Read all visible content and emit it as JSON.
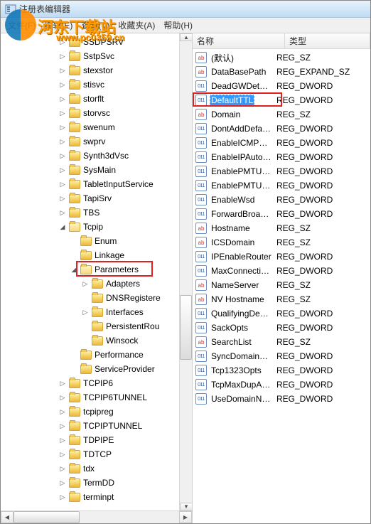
{
  "window": {
    "title": "注册表编辑器"
  },
  "menu": {
    "file": "文件(F)",
    "edit": "编辑(E)",
    "view": "查看(V)",
    "favorites": "收藏夹(A)",
    "help": "帮助(H)"
  },
  "watermark": {
    "main": "河东下载站",
    "sub": "www.pc0359.cn"
  },
  "tree": {
    "nodes": [
      {
        "level": 5,
        "tog": "▷",
        "label": "SSDPSRV"
      },
      {
        "level": 5,
        "tog": "▷",
        "label": "SstpSvc"
      },
      {
        "level": 5,
        "tog": "▷",
        "label": "stexstor"
      },
      {
        "level": 5,
        "tog": "▷",
        "label": "stisvc"
      },
      {
        "level": 5,
        "tog": "▷",
        "label": "storflt"
      },
      {
        "level": 5,
        "tog": "▷",
        "label": "storvsc"
      },
      {
        "level": 5,
        "tog": "▷",
        "label": "swenum"
      },
      {
        "level": 5,
        "tog": "▷",
        "label": "swprv"
      },
      {
        "level": 5,
        "tog": "▷",
        "label": "Synth3dVsc"
      },
      {
        "level": 5,
        "tog": "▷",
        "label": "SysMain"
      },
      {
        "level": 5,
        "tog": "▷",
        "label": "TabletInputService"
      },
      {
        "level": 5,
        "tog": "▷",
        "label": "TapiSrv"
      },
      {
        "level": 5,
        "tog": "▷",
        "label": "TBS"
      },
      {
        "level": 5,
        "tog": "◢",
        "label": "Tcpip",
        "open": true
      },
      {
        "level": 6,
        "tog": " ",
        "label": "Enum"
      },
      {
        "level": 6,
        "tog": " ",
        "label": "Linkage"
      },
      {
        "level": 6,
        "tog": "◢",
        "label": "Parameters",
        "open": true,
        "highlight": true
      },
      {
        "level": 7,
        "tog": "▷",
        "label": "Adapters"
      },
      {
        "level": 7,
        "tog": " ",
        "label": "DNSRegistere"
      },
      {
        "level": 7,
        "tog": "▷",
        "label": "Interfaces"
      },
      {
        "level": 7,
        "tog": " ",
        "label": "PersistentRou"
      },
      {
        "level": 7,
        "tog": " ",
        "label": "Winsock"
      },
      {
        "level": 6,
        "tog": " ",
        "label": "Performance"
      },
      {
        "level": 6,
        "tog": " ",
        "label": "ServiceProvider"
      },
      {
        "level": 5,
        "tog": "▷",
        "label": "TCPIP6"
      },
      {
        "level": 5,
        "tog": "▷",
        "label": "TCPIP6TUNNEL"
      },
      {
        "level": 5,
        "tog": "▷",
        "label": "tcpipreg"
      },
      {
        "level": 5,
        "tog": "▷",
        "label": "TCPIPTUNNEL"
      },
      {
        "level": 5,
        "tog": "▷",
        "label": "TDPIPE"
      },
      {
        "level": 5,
        "tog": "▷",
        "label": "TDTCP"
      },
      {
        "level": 5,
        "tog": "▷",
        "label": "tdx"
      },
      {
        "level": 5,
        "tog": "▷",
        "label": "TermDD"
      },
      {
        "level": 5,
        "tog": "▷",
        "label": "terminpt"
      }
    ]
  },
  "list": {
    "header": {
      "name": "名称",
      "type": "类型"
    },
    "rows": [
      {
        "icon": "sz",
        "name": "(默认)",
        "type": "REG_SZ"
      },
      {
        "icon": "sz",
        "name": "DataBasePath",
        "type": "REG_EXPAND_SZ"
      },
      {
        "icon": "dw",
        "name": "DeadGWDetec...",
        "type": "REG_DWORD"
      },
      {
        "icon": "dw",
        "name": "DefaultTTL",
        "type": "REG_DWORD",
        "selected": true,
        "highlight": true
      },
      {
        "icon": "sz",
        "name": "Domain",
        "type": "REG_SZ"
      },
      {
        "icon": "dw",
        "name": "DontAddDefau...",
        "type": "REG_DWORD"
      },
      {
        "icon": "dw",
        "name": "EnableICMPRe...",
        "type": "REG_DWORD"
      },
      {
        "icon": "dw",
        "name": "EnableIPAutoC...",
        "type": "REG_DWORD"
      },
      {
        "icon": "dw",
        "name": "EnablePMTUB...",
        "type": "REG_DWORD"
      },
      {
        "icon": "dw",
        "name": "EnablePMTUDi...",
        "type": "REG_DWORD"
      },
      {
        "icon": "dw",
        "name": "EnableWsd",
        "type": "REG_DWORD"
      },
      {
        "icon": "dw",
        "name": "ForwardBroad...",
        "type": "REG_DWORD"
      },
      {
        "icon": "sz",
        "name": "Hostname",
        "type": "REG_SZ"
      },
      {
        "icon": "sz",
        "name": "ICSDomain",
        "type": "REG_SZ"
      },
      {
        "icon": "dw",
        "name": "IPEnableRouter",
        "type": "REG_DWORD"
      },
      {
        "icon": "dw",
        "name": "MaxConnectio...",
        "type": "REG_DWORD"
      },
      {
        "icon": "sz",
        "name": "NameServer",
        "type": "REG_SZ"
      },
      {
        "icon": "sz",
        "name": "NV Hostname",
        "type": "REG_SZ"
      },
      {
        "icon": "dw",
        "name": "QualifyingDesti...",
        "type": "REG_DWORD"
      },
      {
        "icon": "dw",
        "name": "SackOpts",
        "type": "REG_DWORD"
      },
      {
        "icon": "sz",
        "name": "SearchList",
        "type": "REG_SZ"
      },
      {
        "icon": "dw",
        "name": "SyncDomainWi...",
        "type": "REG_DWORD"
      },
      {
        "icon": "dw",
        "name": "Tcp1323Opts",
        "type": "REG_DWORD"
      },
      {
        "icon": "dw",
        "name": "TcpMaxDupAc...",
        "type": "REG_DWORD"
      },
      {
        "icon": "dw",
        "name": "UseDomainNa...",
        "type": "REG_DWORD"
      }
    ]
  },
  "icon_glyph": {
    "sz": "ab",
    "dw": "011"
  }
}
